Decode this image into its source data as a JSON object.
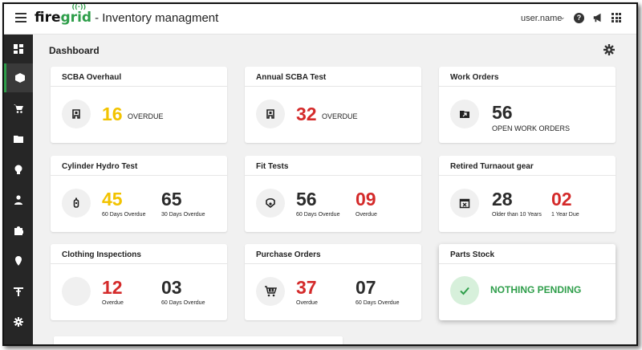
{
  "header": {
    "logo_fire": "fire",
    "logo_grid": "grid",
    "app_title": "- Inventory managment",
    "user_name": "user.name",
    "help_glyph": "?"
  },
  "sidebar": {
    "items": [
      "dashboard-icon",
      "inventory-box-icon",
      "cart-icon",
      "folder-icon",
      "helmet-icon",
      "person-icon",
      "puzzle-icon",
      "location-icon",
      "antenna-icon",
      "gear-icon"
    ],
    "active_index": 1,
    "accent": "#2e9e4a"
  },
  "page": {
    "title": "Dashboard"
  },
  "colors": {
    "yellow": "#f2c300",
    "red": "#d42a2a",
    "green": "#2e9e4a"
  },
  "cards": {
    "scba_overhaul": {
      "title": "SCBA Overhaul",
      "value": "16",
      "label": "OVERDUE"
    },
    "annual_scba": {
      "title": "Annual SCBA Test",
      "value": "32",
      "label": "OVERDUE"
    },
    "work_orders": {
      "title": "Work Orders",
      "value": "56",
      "label": "OPEN  WORK ORDERS"
    },
    "cylinder_hydro": {
      "title": "Cylinder Hydro Test",
      "value1": "45",
      "label1": "60 Days Overdue",
      "value2": "65",
      "label2": "30 Days Overdue"
    },
    "fit_tests": {
      "title": "Fit Tests",
      "value1": "56",
      "label1": "60 Days Overdue",
      "value2": "09",
      "label2": "Overdue"
    },
    "retired_turnout": {
      "title": "Retired Turnaout gear",
      "value1": "28",
      "label1": "Older than 10 Years",
      "value2": "02",
      "label2": "1 Year Due"
    },
    "clothing": {
      "title": "Clothing Inspections",
      "value1": "12",
      "label1": "Overdue",
      "value2": "03",
      "label2": "60 Days Overdue"
    },
    "purchase_orders": {
      "title": "Purchase Orders",
      "value1": "37",
      "label1": "Overdue",
      "value2": "07",
      "label2": "60 Days Overdue"
    },
    "parts_stock": {
      "title": "Parts Stock",
      "status": "NOTHING PENDING"
    }
  }
}
